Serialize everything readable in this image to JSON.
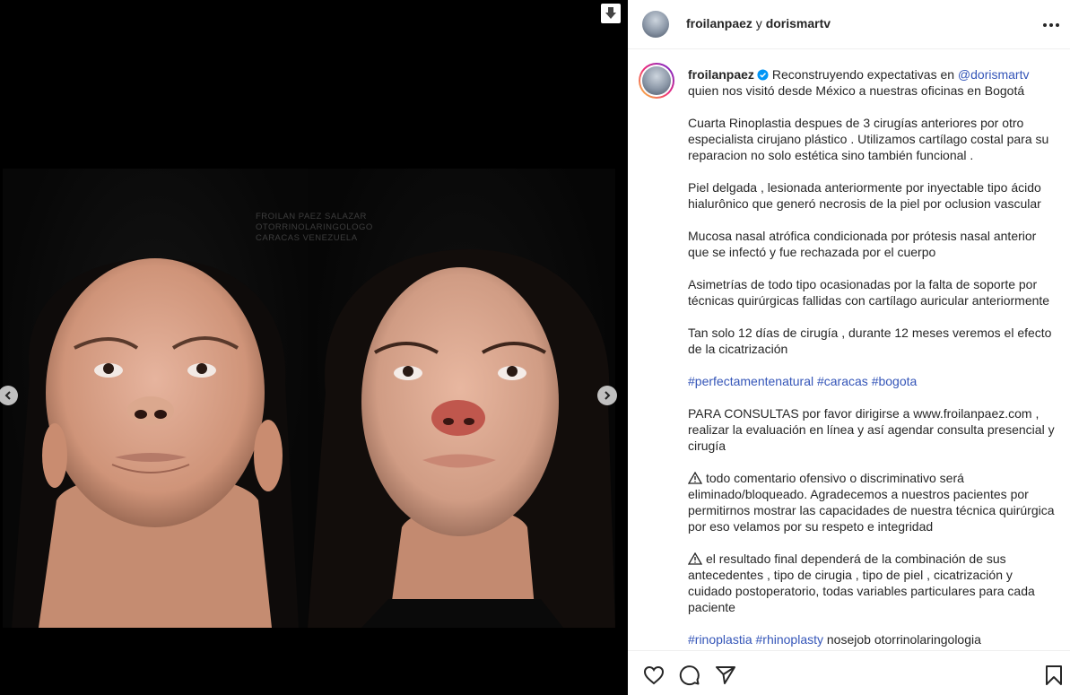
{
  "post": {
    "header": {
      "user1": "froilanpaez",
      "joiner": "y",
      "user2": "dorismartv"
    },
    "watermark": {
      "line1": "FROILAN PAEZ SALAZAR",
      "line2": "OTORRINOLARINGOLOGO",
      "line3": "CARACAS VENEZUELA"
    },
    "caption": {
      "username": "froilanpaez",
      "intro_text": "Reconstruyendo expectativas en",
      "mention": "@dorismartv",
      "intro_cont": "quien nos visitó desde México a nuestras oficinas en Bogotá",
      "p2": "Cuarta Rinoplastia despues de 3 cirugías anteriores por otro especialista cirujano plástico . Utilizamos cartílago costal para su reparacion no solo estética sino también funcional .",
      "p3": "Piel delgada , lesionada anteriormente por inyectable tipo ácido hialurônico que generó necrosis de la piel por oclusion vascular",
      "p4": "Mucosa nasal atrófica condicionada por prótesis nasal anterior que se infectó y fue rechazada por el cuerpo",
      "p5": "Asimetrías de todo tipo ocasionadas por la falta de soporte por técnicas quirúrgicas fallidas con cartílago auricular anteriormente",
      "p6": "Tan solo 12 días de cirugía , durante 12 meses veremos el efecto de la cicatrización",
      "hashtags1": [
        "#perfectamentenatural",
        "#caracas",
        "#bogota"
      ],
      "p8": "PARA CONSULTAS por favor dirigirse a www.froilanpaez.com , realizar la evaluación en línea y así agendar consulta presencial y cirugía",
      "p9": "todo comentario ofensivo o discriminativo será eliminado/bloqueado. Agradecemos a nuestros pacientes por permitirnos mostrar las capacidades de nuestra técnica quirúrgica por eso velamos por su respeto e integridad",
      "p10": "el resultado final dependerá de la combinación de sus antecedentes , tipo de cirugia , tipo de piel , cicatrización y cuidado postoperatorio, todas variables particulares para cada paciente",
      "hashtags2": [
        "#rinoplastia",
        "#rhinoplasty"
      ],
      "trailing": "nosejob otorrinolaringologia"
    }
  },
  "colors": {
    "link": "#3455b8",
    "text": "#262626",
    "media_bg": "#000000",
    "panel_bg": "#ffffff"
  },
  "icons": [
    "download-icon",
    "chevron-left-icon",
    "chevron-right-icon",
    "more-icon",
    "verified-icon",
    "warning-icon",
    "heart-icon",
    "comment-icon",
    "share-icon",
    "bookmark-icon"
  ]
}
